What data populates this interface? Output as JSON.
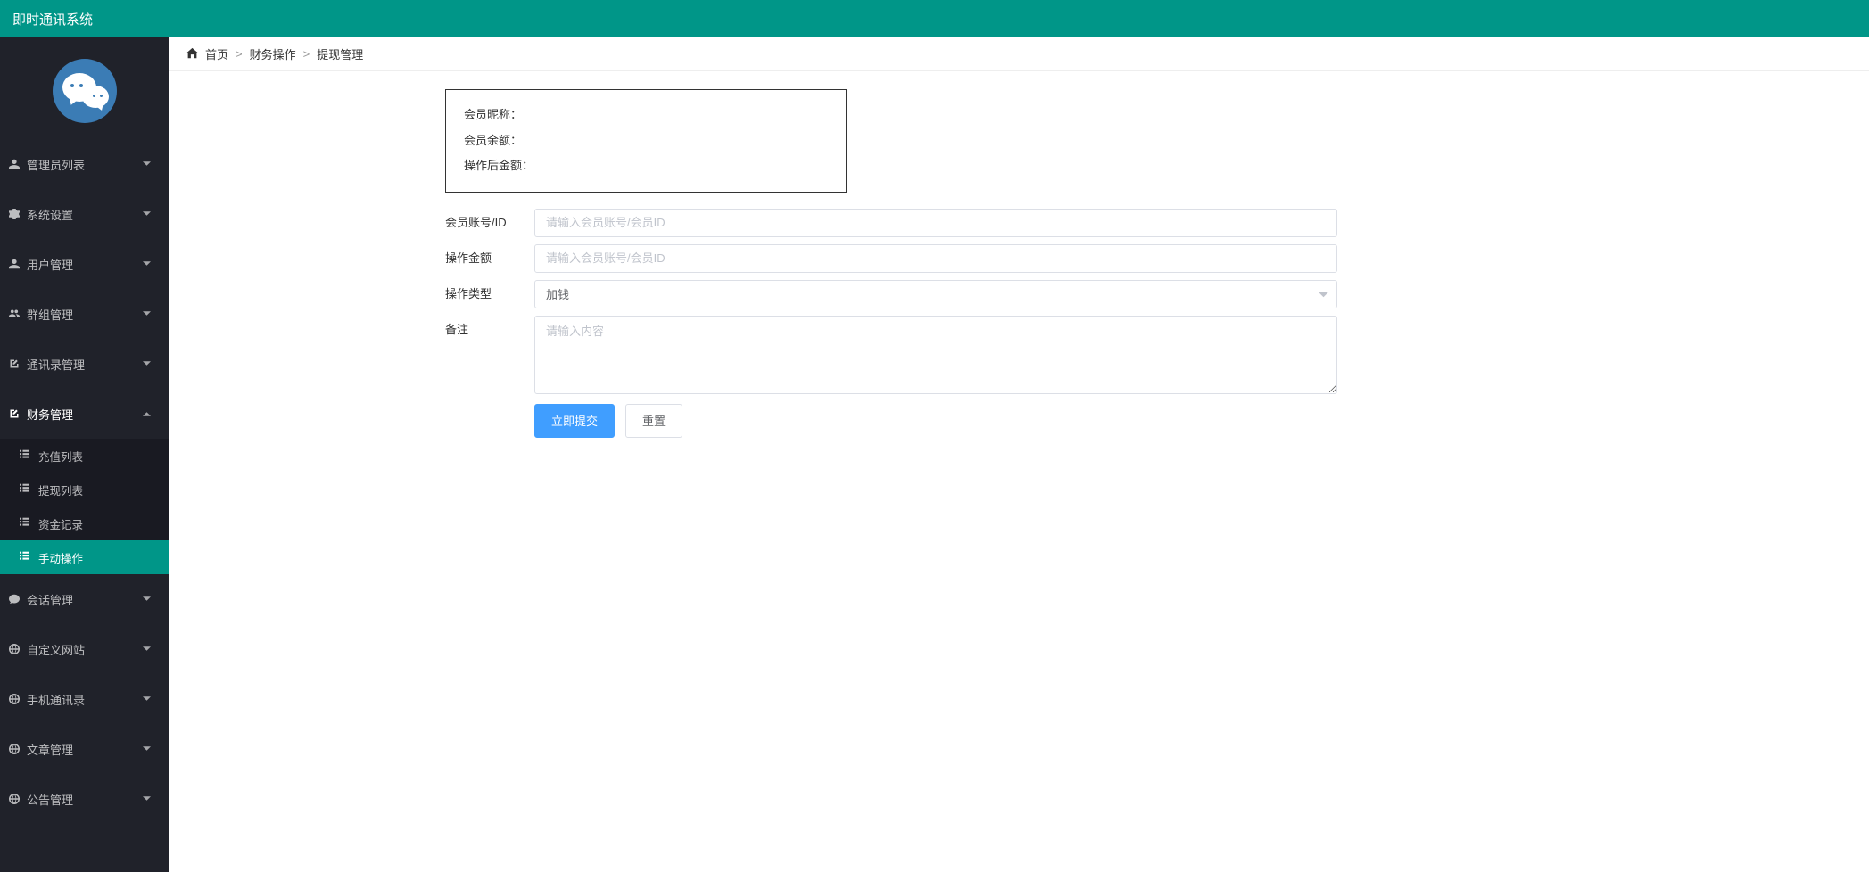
{
  "header": {
    "title": "即时通讯系统"
  },
  "sidebar": {
    "items": [
      {
        "icon": "user",
        "label": "管理员列表"
      },
      {
        "icon": "gear",
        "label": "系统设置"
      },
      {
        "icon": "user",
        "label": "用户管理"
      },
      {
        "icon": "users",
        "label": "群组管理"
      },
      {
        "icon": "book",
        "label": "通讯录管理"
      },
      {
        "icon": "edit",
        "label": "财务管理",
        "expanded": true,
        "children": [
          {
            "label": "充值列表"
          },
          {
            "label": "提现列表"
          },
          {
            "label": "资金记录"
          },
          {
            "label": "手动操作",
            "active": true
          }
        ]
      },
      {
        "icon": "chat",
        "label": "会话管理"
      },
      {
        "icon": "globe",
        "label": "自定义网站"
      },
      {
        "icon": "phone",
        "label": "手机通讯录"
      },
      {
        "icon": "doc",
        "label": "文章管理"
      },
      {
        "icon": "bell",
        "label": "公告管理"
      }
    ]
  },
  "breadcrumb": {
    "home": "首页",
    "level1": "财务操作",
    "level2": "提现管理"
  },
  "info_box": {
    "row1": "会员昵称：",
    "row2": "会员余额：",
    "row3": "操作后金额："
  },
  "form": {
    "account_label": "会员账号/ID",
    "account_placeholder": "请输入会员账号/会员ID",
    "amount_label": "操作金额",
    "amount_placeholder": "请输入会员账号/会员ID",
    "type_label": "操作类型",
    "type_value": "加钱",
    "remark_label": "备注",
    "remark_placeholder": "请输入内容",
    "submit_label": "立即提交",
    "reset_label": "重置"
  }
}
